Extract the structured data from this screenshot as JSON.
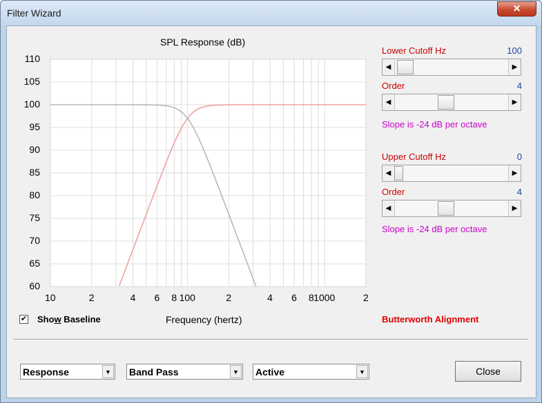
{
  "window": {
    "title": "Filter Wizard",
    "close_glyph": "✕"
  },
  "chart_data": {
    "type": "line",
    "title": "SPL Response (dB)",
    "xlabel": "Frequency (hertz)",
    "xscale": "log",
    "xlim": [
      10,
      2000
    ],
    "ylim": [
      60,
      110
    ],
    "yticks": [
      "110",
      "105",
      "100",
      "95",
      "90",
      "85",
      "80",
      "75",
      "70",
      "65",
      "60"
    ],
    "xticks": [
      "10",
      "2",
      "4",
      "6",
      "8",
      "100",
      "2",
      "4",
      "6",
      "8",
      "1000",
      "2"
    ],
    "grid": true,
    "series": [
      {
        "color": "#f2a0a0",
        "filter": "highpass",
        "cutoff": 100,
        "order": 4
      },
      {
        "color": "#b8b8b8",
        "filter": "lowpass",
        "cutoff": 100,
        "order": 4
      }
    ]
  },
  "lower": {
    "label": "Lower Cutoff  Hz",
    "value": "100",
    "slider": 0.1
  },
  "lower_order": {
    "label": "Order",
    "value": "4",
    "slider": 0.4,
    "slope": "Slope is -24 dB per octave"
  },
  "upper": {
    "label": "Upper Cutoff  Hz",
    "value": "0",
    "slider": 0.0
  },
  "upper_order": {
    "label": "Order",
    "value": "4",
    "slider": 0.4,
    "slope": "Slope is -24 dB per octave"
  },
  "alignment": "Butterworth Alignment",
  "baseline": {
    "label": "Show Baseline",
    "checked": true,
    "check_glyph": "✔"
  },
  "dropdowns": {
    "view": "Response",
    "type": "Band Pass",
    "mode": "Active"
  },
  "close_button": "Close",
  "arrows": {
    "left": "◀",
    "right": "▶",
    "down": "▼"
  }
}
